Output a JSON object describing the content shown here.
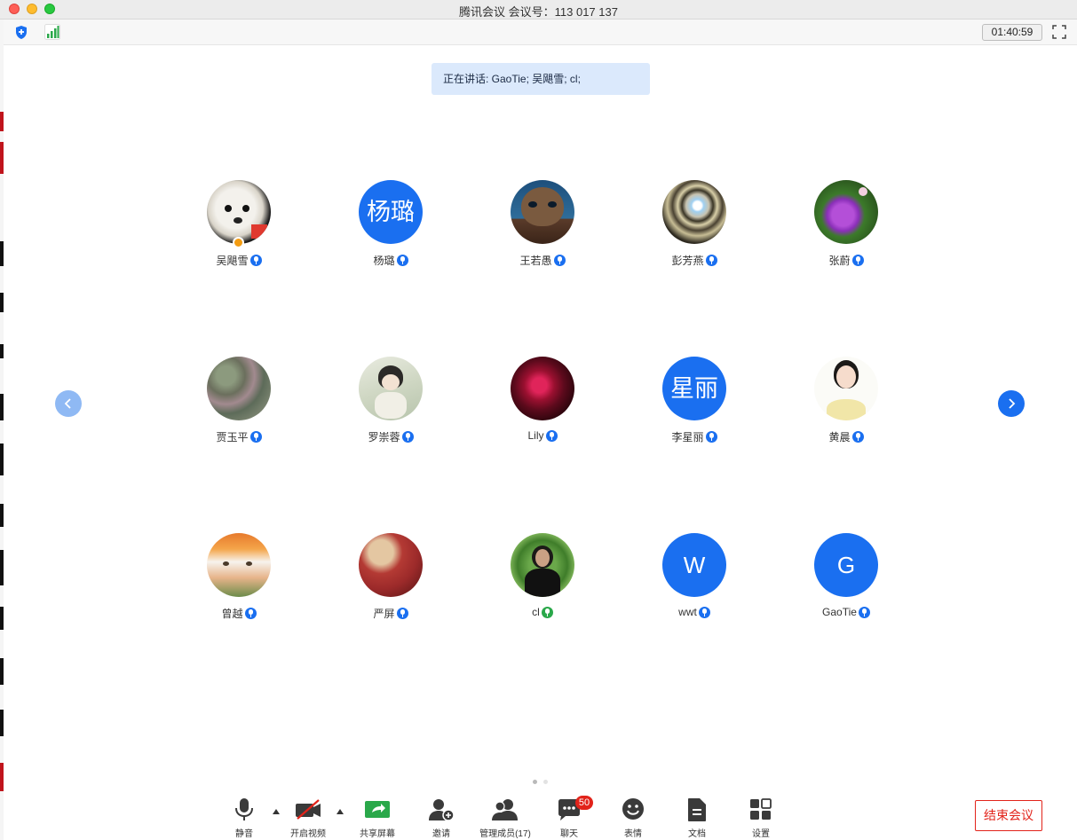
{
  "window": {
    "title": "腾讯会议 会议号：113 017 137"
  },
  "toolbar": {
    "timer": "01:40:59",
    "icons": [
      "shield-icon",
      "signal-icon",
      "fullscreen-icon"
    ]
  },
  "speaking": {
    "label": "正在讲话: GaoTie; 吴飓雪; cl;"
  },
  "participants": [
    {
      "name": "吴飓雪",
      "avatar_type": "photo",
      "mic": "mic-icon",
      "host": true
    },
    {
      "name": "杨璐",
      "avatar_type": "text",
      "avatar_text": "杨璐",
      "mic": "mic-icon"
    },
    {
      "name": "王若愚",
      "avatar_type": "photo",
      "mic": "mic-icon"
    },
    {
      "name": "彭芳燕",
      "avatar_type": "photo",
      "mic": "mic-icon"
    },
    {
      "name": "张蔚",
      "avatar_type": "photo",
      "mic": "mic-icon"
    },
    {
      "name": "贾玉平",
      "avatar_type": "photo",
      "mic": "mic-icon"
    },
    {
      "name": "罗崇蓉",
      "avatar_type": "photo",
      "mic": "mic-icon"
    },
    {
      "name": "Lily",
      "avatar_type": "photo",
      "mic": "mic-icon"
    },
    {
      "name": "李星丽",
      "avatar_type": "text",
      "avatar_text": "星丽",
      "mic": "mic-icon"
    },
    {
      "name": "黄晨",
      "avatar_type": "photo",
      "mic": "mic-icon"
    },
    {
      "name": "曾越",
      "avatar_type": "photo",
      "mic": "mic-icon"
    },
    {
      "name": "严屏",
      "avatar_type": "photo",
      "mic": "mic-icon"
    },
    {
      "name": "cl",
      "avatar_type": "photo",
      "mic": "mic-active-icon"
    },
    {
      "name": "wwt",
      "avatar_type": "text",
      "avatar_text": "W",
      "mic": "mic-icon"
    },
    {
      "name": "GaoTie",
      "avatar_type": "text",
      "avatar_text": "G",
      "mic": "mic-icon"
    }
  ],
  "pager": {
    "pages": 2,
    "current": 1
  },
  "bottombar": {
    "mute": "静音",
    "video": "开启视频",
    "share": "共享屏幕",
    "invite": "邀请",
    "members": "管理成员(17)",
    "chat": "聊天",
    "chat_badge": "50",
    "emoji": "表情",
    "docs": "文档",
    "settings": "设置",
    "end": "结束会议"
  },
  "colors": {
    "accent": "#1a6ff0",
    "end": "#e2231a",
    "banner": "#dbe9fc"
  }
}
